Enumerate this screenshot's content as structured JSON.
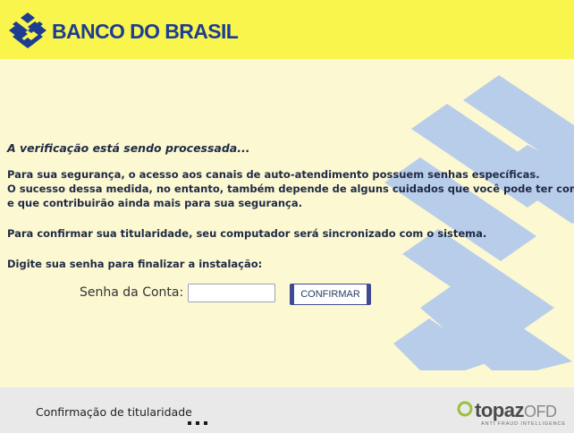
{
  "header": {
    "logo_text": "BANCO DO BRASIL",
    "logo_icon": "banco-do-brasil-logo",
    "background_color": "#f9f54c",
    "brand_color": "#1c3d92"
  },
  "main": {
    "status_title": "A verificação está sendo processada...",
    "paragraph1_line1": "Para sua segurança, o acesso aos canais de auto-atendimento possuem senhas específicas.",
    "paragraph1_line2": "O sucesso dessa medida, no entanto, também depende de alguns cuidados que você pode ter com suas senhas",
    "paragraph1_line3": "e que contribuirão ainda mais para sua segurança.",
    "paragraph2": "Para confirmar sua titularidade, seu computador será sincronizado com o sistema.",
    "paragraph3": "Digite sua senha para finalizar a instalação:",
    "password_label": "Senha da Conta:",
    "password_value": "",
    "confirm_button": "CONFIRMAR",
    "background_color": "#fbf8d2",
    "watermark_color": "#b8cdea"
  },
  "footer": {
    "text": "Confirmação de titularidade",
    "brand_name": "topaz",
    "brand_suffix": "OFD",
    "brand_tagline": "ANTI FRAUD INTELLIGENCE",
    "background_color": "#e9e9e9"
  }
}
